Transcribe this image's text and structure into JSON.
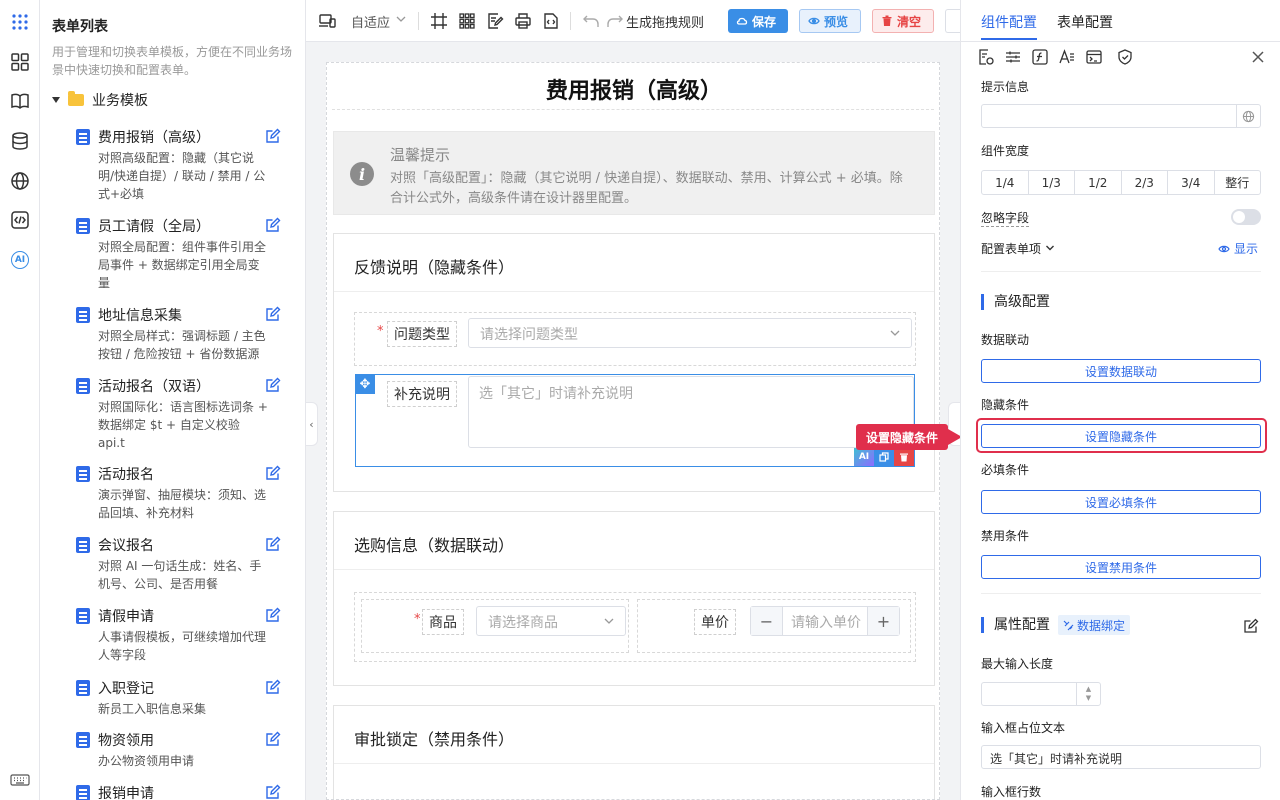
{
  "sidebar_list": {
    "title": "表单列表",
    "description": "用于管理和切换表单模板，方便在不同业务场景中快速切换和配置表单。",
    "group_label": "业务模板",
    "items": [
      {
        "name": "费用报销（高级）",
        "desc": "对照高级配置：隐藏（其它说明/快递自提）/ 联动 / 禁用 / 公式+必填"
      },
      {
        "name": "员工请假（全局）",
        "desc": "对照全局配置：组件事件引用全局事件 + 数据绑定引用全局变量"
      },
      {
        "name": "地址信息采集",
        "desc": "对照全局样式：强调标题 / 主色按钮 / 危险按钮 + 省份数据源"
      },
      {
        "name": "活动报名（双语）",
        "desc": "对照国际化：语言图标选词条 + 数据绑定 $t + 自定义校验 api.t"
      },
      {
        "name": "活动报名",
        "desc": "演示弹窗、抽屉模块：须知、选品回填、补充材料"
      },
      {
        "name": "会议报名",
        "desc": "对照 AI 一句话生成：姓名、手机号、公司、是否用餐"
      },
      {
        "name": "请假申请",
        "desc": "人事请假模板，可继续增加代理人等字段"
      },
      {
        "name": "入职登记",
        "desc": "新员工入职信息采集"
      },
      {
        "name": "物资领用",
        "desc": "办公物资领用申请"
      },
      {
        "name": "报销申请",
        "desc": ""
      }
    ]
  },
  "toolbar": {
    "zoom_label": "自适应",
    "rules_label": "生成拖拽规则",
    "save_label": "保存",
    "preview_label": "预览",
    "clear_label": "清空"
  },
  "canvas": {
    "form_title": "费用报销（高级）",
    "tip_title": "温馨提示",
    "tip_body": "对照「高级配置」：隐藏（其它说明 / 快递自提）、数据联动、禁用、计算公式 + 必填。除合计公式外，高级条件请在设计器里配置。",
    "sections": [
      {
        "title": "反馈说明（隐藏条件）"
      },
      {
        "title": "选购信息（数据联动）"
      },
      {
        "title": "审批锁定（禁用条件）"
      }
    ],
    "fields": {
      "issue_type_label": "问题类型",
      "issue_type_placeholder": "请选择问题类型",
      "extra_label": "补充说明",
      "extra_placeholder": "选「其它」时请补充说明",
      "product_label": "商品",
      "product_placeholder": "请选择商品",
      "price_label": "单价",
      "price_placeholder": "请输入单价",
      "minus": "−",
      "plus": "+"
    },
    "mini_tools": {
      "ai": "AI"
    },
    "tooltip": "设置隐藏条件"
  },
  "panel": {
    "tabs": [
      "组件配置",
      "表单配置"
    ],
    "hint_label": "提示信息",
    "width_label": "组件宽度",
    "width_options": [
      "1/4",
      "1/3",
      "1/2",
      "2/3",
      "3/4",
      "整行"
    ],
    "ignore_label": "忽略字段",
    "config_items_label": "配置表单项",
    "show_label": "显示",
    "advanced_heading": "高级配置",
    "linkage_label": "数据联动",
    "linkage_btn": "设置数据联动",
    "hidden_label": "隐藏条件",
    "hidden_btn": "设置隐藏条件",
    "required_label": "必填条件",
    "required_btn": "设置必填条件",
    "disabled_label": "禁用条件",
    "disabled_btn": "设置禁用条件",
    "props_heading": "属性配置",
    "binding_badge": "数据绑定",
    "maxlen_label": "最大输入长度",
    "placeholder_label": "输入框占位文本",
    "placeholder_value": "选「其它」时请补充说明",
    "rows_label": "输入框行数"
  },
  "colors": {
    "primary": "#2f6ae8",
    "danger": "#e02f4c",
    "folder": "#f8c33b"
  }
}
